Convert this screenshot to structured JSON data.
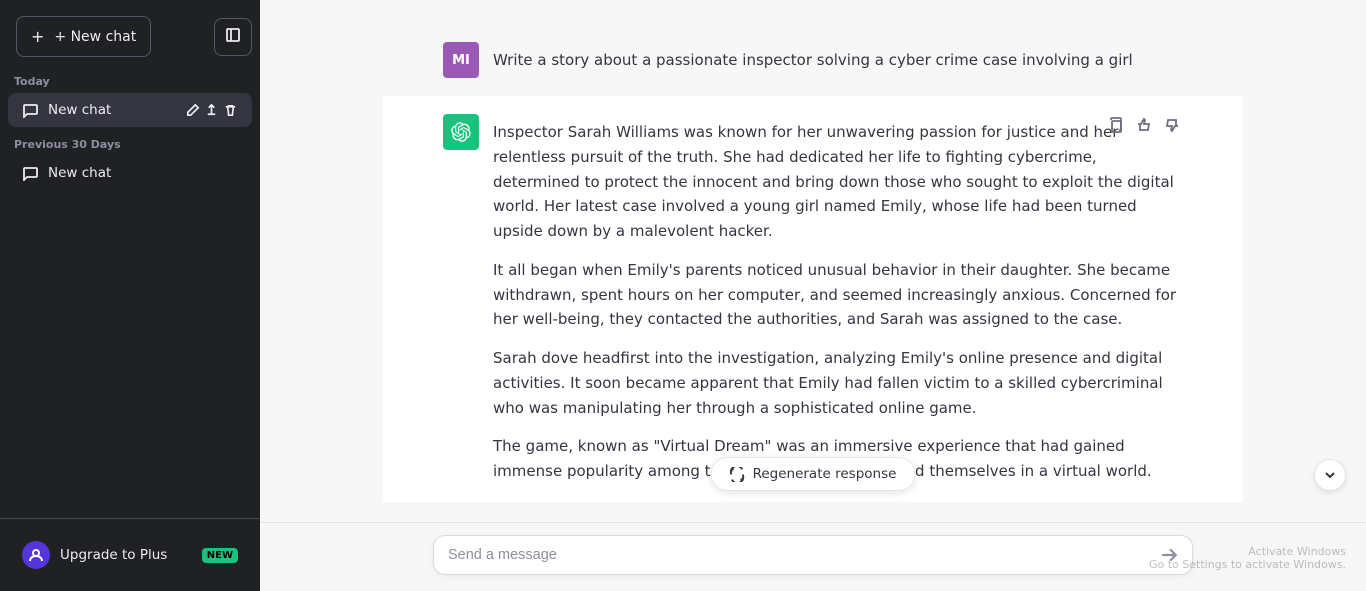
{
  "sidebar": {
    "new_chat_button": "+ New chat",
    "sidebar_icon": "□",
    "today_label": "Today",
    "today_chat": "New chat",
    "previous_label": "Previous 30 Days",
    "prev_chat": "New chat",
    "upgrade_label": "Upgrade to Plus",
    "new_badge": "NEW",
    "user_initials": "U"
  },
  "chat": {
    "user_initials": "MI",
    "user_prompt": "Write a story about a passionate inspector solving a cyber crime case involving a girl",
    "assistant_paragraphs": [
      "Inspector Sarah Williams was known for her unwavering passion for justice and her relentless pursuit of the truth. She had dedicated her life to fighting cybercrime, determined to protect the innocent and bring down those who sought to exploit the digital world. Her latest case involved a young girl named Emily, whose life had been turned upside down by a malevolent hacker.",
      "It all began when Emily's parents noticed unusual behavior in their daughter. She became withdrawn, spent hours on her computer, and seemed increasingly anxious. Concerned for her well-being, they contacted the authorities, and Sarah was assigned to the case.",
      "Sarah dove headfirst into the investigation, analyzing Emily's online presence and digital activities. It soon became apparent that Emily had fallen victim to a skilled cybercriminal who was manipulating her through a sophisticated online game.",
      "The game, known as \"Virtual Dream\" was an immersive experience that had gained immense popularity among teenagers. Players immersed themselves in a virtual world."
    ],
    "regenerate_label": "Regenerate response",
    "send_placeholder": "Send a message"
  },
  "watermark": {
    "line1": "Activate Windows",
    "line2": "Go to Settings to activate Windows."
  }
}
